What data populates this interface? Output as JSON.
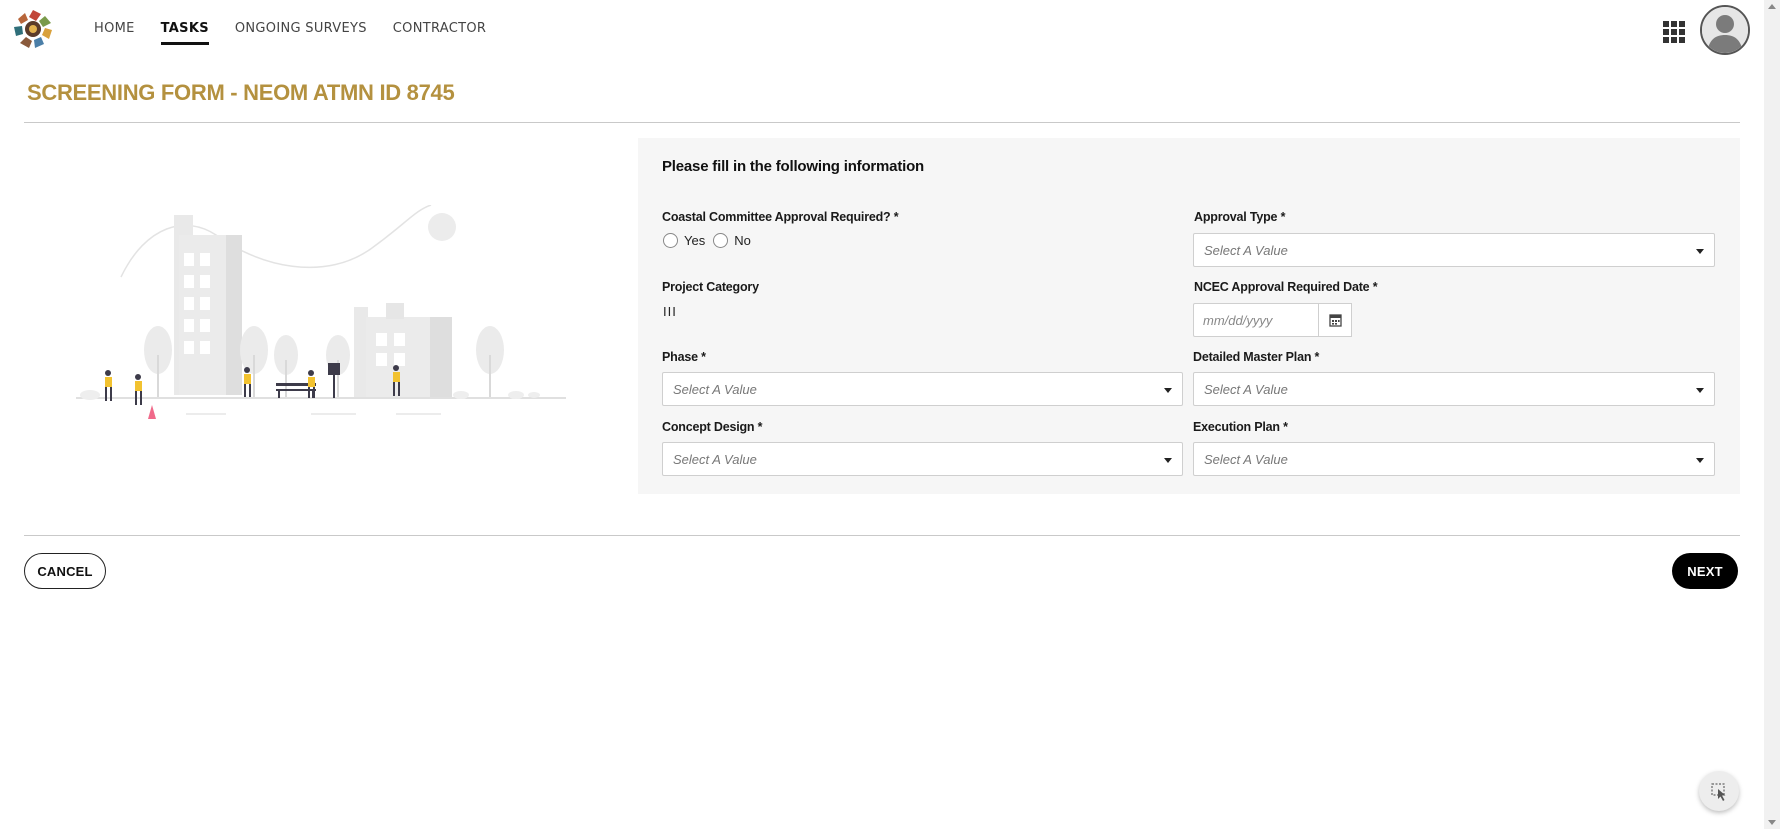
{
  "nav": {
    "items": [
      {
        "label": "HOME",
        "active": false
      },
      {
        "label": "TASKS",
        "active": true
      },
      {
        "label": "ONGOING SURVEYS",
        "active": false
      },
      {
        "label": "CONTRACTOR",
        "active": false
      }
    ],
    "icons": [
      "apps-grid-icon",
      "user-avatar-icon",
      "logo"
    ]
  },
  "page": {
    "title": "SCREENING FORM - NEOM ATMN ID 8745"
  },
  "form": {
    "heading": "Please fill in the following information",
    "coastal": {
      "label": "Coastal Committee Approval Required? *",
      "options": [
        "Yes",
        "No"
      ]
    },
    "approval_type": {
      "label": "Approval Type *",
      "placeholder": "Select A Value"
    },
    "project_category": {
      "label": "Project Category",
      "value": "III"
    },
    "ncec_date": {
      "label": "NCEC Approval Required Date *",
      "placeholder": "mm/dd/yyyy"
    },
    "phase": {
      "label": "Phase *",
      "placeholder": "Select A Value"
    },
    "detailed_master_plan": {
      "label": "Detailed Master Plan *",
      "placeholder": "Select A Value"
    },
    "concept_design": {
      "label": "Concept Design *",
      "placeholder": "Select A Value"
    },
    "execution_plan": {
      "label": "Execution Plan *",
      "placeholder": "Select A Value"
    }
  },
  "footer": {
    "cancel_label": "CANCEL",
    "next_label": "NEXT"
  },
  "colors": {
    "title_gold": "#b4913f",
    "panel_bg": "#f6f6f6",
    "figure_yellow": "#f2c230"
  }
}
